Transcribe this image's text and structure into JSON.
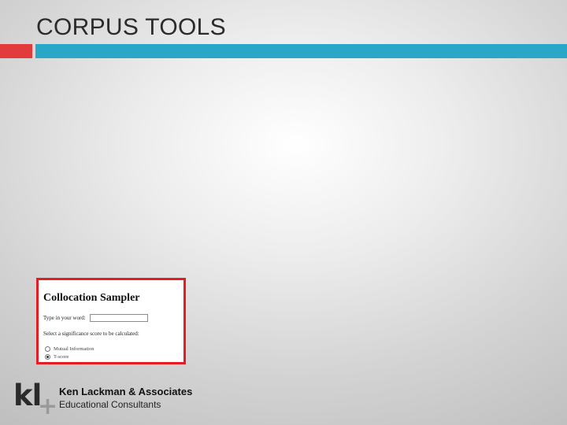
{
  "slide": {
    "title": "CORPUS TOOLS",
    "colors": {
      "accent_red": "#e23b3b",
      "accent_blue": "#2aa6c6",
      "frame_red": "#e21e24"
    }
  },
  "sampler": {
    "title": "Collocation Sampler",
    "word_label": "Type in your word:",
    "word_value": "",
    "score_label": "Select a significance score to be calculated:",
    "options": [
      {
        "label": "Mutual Information",
        "selected": false
      },
      {
        "label": "T-score",
        "selected": true
      }
    ]
  },
  "footer": {
    "logo_text": "kl",
    "logo_plus": "+",
    "company": "Ken Lackman & Associates",
    "tagline": "Educational Consultants"
  }
}
